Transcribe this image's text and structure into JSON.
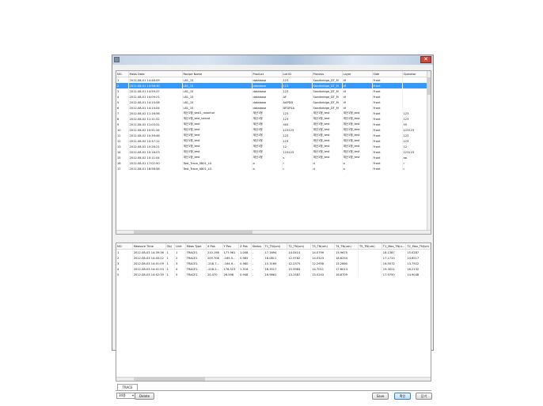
{
  "top_table": {
    "columns": [
      "NO.",
      "Meas Date",
      "Recipe Name",
      "Product",
      "Lot ID",
      "Process",
      "Layer",
      "Side",
      "Operator"
    ],
    "rows": [
      [
        "1",
        "2012-08-01 14:48:09",
        "L81_15",
        "database",
        "123",
        "Sandbridge_DT_M",
        "4f",
        "Front",
        ""
      ],
      [
        "2",
        "2012-08-01 14:56:30",
        "L81_15",
        "database",
        "123",
        "Sandbridge_DT_M",
        "4f",
        "Front",
        ""
      ],
      [
        "3",
        "2012-08-01 14:59:37",
        "L81_15",
        "database",
        "123",
        "Sandbridge_DT_M",
        "4f",
        "Front",
        ""
      ],
      [
        "4",
        "2012-08-01 14:09:21",
        "L81_15",
        "database",
        "AF",
        "Sandbridge_DT_M",
        "4f",
        "Front",
        ""
      ],
      [
        "5",
        "2012-08-01 14:10:08",
        "L81_15",
        "database",
        "AAPDD",
        "Sandbridge_DT_M",
        "4f",
        "Front",
        ""
      ],
      [
        "6",
        "2012-08-01 14:14:04",
        "L81_15",
        "database",
        "DFDFSA",
        "Sandbridge_DT_M",
        "4f",
        "Front",
        ""
      ],
      [
        "7",
        "2012-08-02 11:16:56",
        "계산1형_test1_rownhor",
        "계산1형",
        "123",
        "계산1형_test",
        "계산1형_test",
        "Front",
        "123"
      ],
      [
        "8",
        "2012-08-02 11:11:52",
        "계산1형_test_loland",
        "계산1형",
        "123",
        "계산1형_test",
        "계산1형_test",
        "Front",
        "123"
      ],
      [
        "9",
        "2012-08-02 11:03:31",
        "계산1형_test",
        "계산1형",
        "405",
        "계산1형_test",
        "계산1형_test",
        "Front",
        "55"
      ],
      [
        "10",
        "2012-08-02 10:51:34",
        "계산1형_test",
        "계산1형",
        "123123",
        "계산1형_test",
        "계산1형_test",
        "Front",
        "123123"
      ],
      [
        "11",
        "2012-08-02 10:39:46",
        "계산1형_test",
        "계산1형",
        "123",
        "계산1형_test",
        "계산1형_test",
        "Front",
        "123"
      ],
      [
        "12",
        "2012-08-02 10:37:12",
        "계산1형_test",
        "계산1형",
        "123",
        "계산1형_test",
        "계산1형_test",
        "Front",
        "123"
      ],
      [
        "13",
        "2012-08-02 10:26:21",
        "계산1형_test",
        "계산1형",
        "12",
        "계산1형_test",
        "계산1형_test",
        "Front",
        "12"
      ],
      [
        "14",
        "2012-08-02 10:16:03",
        "계산1형_test",
        "계산1형",
        "123123",
        "계산1형_test",
        "계산1형_test",
        "Front",
        "123123"
      ],
      [
        "15",
        "2012-08-02 10:11:04",
        "계산1형_test",
        "계산1형",
        "s",
        "계산1형_test",
        "계산1형_test",
        "Front",
        "aa"
      ],
      [
        "16",
        "2012-08-01 17:02:50",
        "Test_Trace_0801_LG",
        "a",
        "r",
        "d",
        "a",
        "Front",
        "r"
      ],
      [
        "17",
        "2012-08-01 16:58:56",
        "Test_Trace_0801_LG",
        "a",
        "r",
        "d",
        "a",
        "Front",
        "r"
      ]
    ],
    "selected_row": 1
  },
  "bottom_table": {
    "columns": [
      "NO.",
      "Measure Time",
      "Obj",
      "Unit",
      "Meas Type",
      "X Pos",
      "Y Pos",
      "Z Pos",
      "Status",
      "T1_TN(um)",
      "T2_TN(um)",
      "T3_TN(um)",
      "T4_TN(um)",
      "T5_TN(um)",
      "T1_Max_TN(u...",
      "T2_Max_TN(um"
    ],
    "rows": [
      [
        "1",
        "2012-08-03 14:39:36",
        "1",
        "1",
        "TRACE1",
        "210.198",
        "177.961",
        "1.008",
        "-",
        "17.1694",
        "14.0414",
        "14.0799",
        "15.9675",
        "",
        "18.1387",
        "15.0287"
      ],
      [
        "2",
        "2012-08-03 14:40:22",
        "1",
        "2",
        "TRACE1",
        "209.708",
        "-165.5...",
        "0.985",
        "-",
        "16.0811",
        "12.9782",
        "14.0323",
        "18.6254",
        "",
        "17.1720",
        "14.6517"
      ],
      [
        "3",
        "2012-08-03 14:41:09",
        "1",
        "3",
        "TRACE1",
        "-218.7...",
        "-164.9...",
        "0.980",
        "-",
        "15.3169",
        "12.2375",
        "12.2958",
        "15.2660",
        "",
        "16.5072",
        "13.7922"
      ],
      [
        "4",
        "2012-08-03 14:41:54",
        "1",
        "4",
        "TRACE1",
        "-218.2...",
        "178.523",
        "1.516",
        "-",
        "18.3517",
        "15.5983",
        "14.7011",
        "17.6013",
        "",
        "19.3021",
        "16.2132"
      ],
      [
        "5",
        "2012-08-03 14:42:39",
        "1",
        "5",
        "TRACE1",
        "20.470",
        "26.598",
        "0.948",
        "-",
        "16.9861",
        "13.2587",
        "13.5243",
        "16.6709",
        "",
        "17.9750",
        "14.9048"
      ]
    ]
  },
  "tab": {
    "label": "TRACE"
  },
  "footer": {
    "select_value": "34종",
    "delete_label": "Delete",
    "save_label": "Save",
    "ok_label": "확인",
    "close_label": "닫기"
  }
}
